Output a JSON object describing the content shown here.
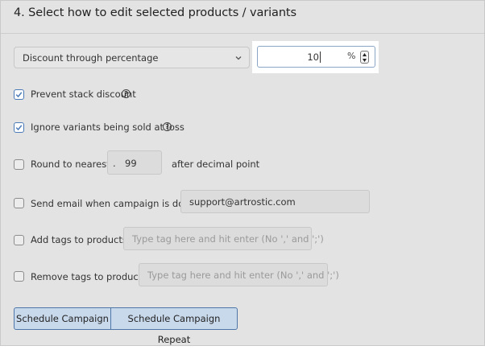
{
  "section": {
    "title": "4. Select how to edit selected products / variants"
  },
  "edit_method": {
    "selected": "Discount through percentage"
  },
  "amount": {
    "value": "10",
    "unit": "%"
  },
  "options": {
    "prevent_stack": {
      "label": "Prevent stack discount",
      "checked": true
    },
    "ignore_loss": {
      "label": "Ignore variants being sold at loss",
      "checked": true
    },
    "round": {
      "label": "Round to nearest",
      "prefix": ".",
      "value": "99",
      "suffix": "after decimal point",
      "checked": false
    },
    "send_email": {
      "label": "Send email when campaign is done",
      "email": "support@artrostic.com",
      "checked": false
    },
    "add_tags": {
      "label": "Add tags to products",
      "placeholder": "Type tag here and hit enter (No ',' and ';')",
      "checked": false
    },
    "remove_tags": {
      "label": "Remove tags to products",
      "placeholder": "Type tag here and hit enter (No ',' and ';')",
      "checked": false
    }
  },
  "actions": {
    "schedule": "Schedule Campaign",
    "schedule_repeat": "Schedule Campaign Repeat"
  },
  "colors": {
    "accent": "#4a7ab8",
    "panel_bg": "#e3e3e3",
    "button_bg": "#c9d9ec"
  }
}
